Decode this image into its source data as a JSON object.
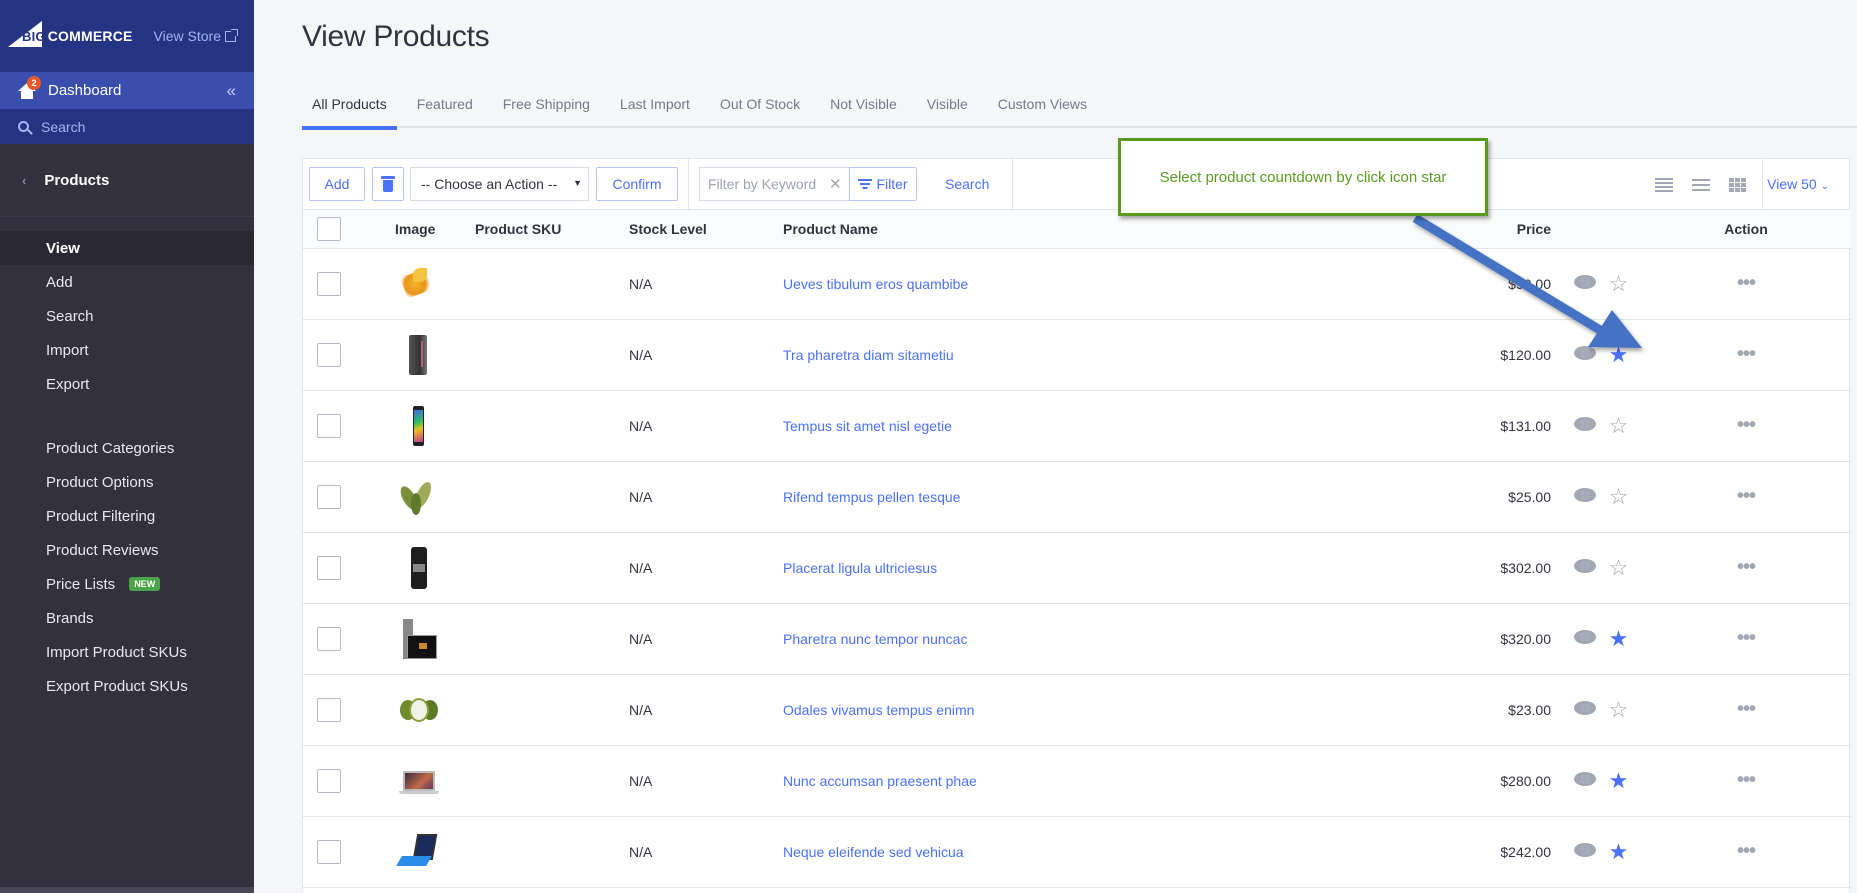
{
  "sidebar": {
    "brand": {
      "big": "BIG",
      "commerce": "COMMERCE"
    },
    "view_store": "View Store",
    "dashboard": {
      "label": "Dashboard",
      "badge": "2"
    },
    "search": "Search",
    "section_title": "Products",
    "items": [
      {
        "label": "View",
        "active": true
      },
      {
        "label": "Add"
      },
      {
        "label": "Search"
      },
      {
        "label": "Import"
      },
      {
        "label": "Export"
      }
    ],
    "items2": [
      {
        "label": "Product Categories"
      },
      {
        "label": "Product Options"
      },
      {
        "label": "Product Filtering"
      },
      {
        "label": "Product Reviews"
      },
      {
        "label": "Price Lists",
        "badge": "NEW"
      },
      {
        "label": "Brands"
      },
      {
        "label": "Import Product SKUs"
      },
      {
        "label": "Export Product SKUs"
      }
    ]
  },
  "page": {
    "title": "View Products",
    "tabs": [
      "All Products",
      "Featured",
      "Free Shipping",
      "Last Import",
      "Out Of Stock",
      "Not Visible",
      "Visible",
      "Custom Views"
    ],
    "active_tab": "All Products"
  },
  "toolbar": {
    "add_label": "Add",
    "action_select": "-- Choose an Action --",
    "confirm_label": "Confirm",
    "filter_placeholder": "Filter by Keyword",
    "filter_label": "Filter",
    "search_label": "Search",
    "view_count": "View 50"
  },
  "table": {
    "columns": [
      "Image",
      "Product SKU",
      "Stock Level",
      "Product Name",
      "Price",
      "Action"
    ],
    "rows": [
      {
        "sku": "",
        "stock": "N/A",
        "name": "Ueves tibulum eros quambibe",
        "price": "$99.00",
        "featured": false,
        "img": "flower"
      },
      {
        "sku": "",
        "stock": "N/A",
        "name": "Tra pharetra diam sitametiu",
        "price": "$120.00",
        "featured": true,
        "img": "phone-dark"
      },
      {
        "sku": "",
        "stock": "N/A",
        "name": "Tempus sit amet nisl egetie",
        "price": "$131.00",
        "featured": false,
        "img": "phone-color"
      },
      {
        "sku": "",
        "stock": "N/A",
        "name": "Rifend tempus pellen tesque",
        "price": "$25.00",
        "featured": false,
        "img": "peppers"
      },
      {
        "sku": "",
        "stock": "N/A",
        "name": "Placerat ligula ultriciesus",
        "price": "$302.00",
        "featured": false,
        "img": "phone-black"
      },
      {
        "sku": "",
        "stock": "N/A",
        "name": "Pharetra nunc tempor nuncac",
        "price": "$320.00",
        "featured": true,
        "img": "tablet"
      },
      {
        "sku": "",
        "stock": "N/A",
        "name": "Odales vivamus tempus enimn",
        "price": "$23.00",
        "featured": false,
        "img": "fruit"
      },
      {
        "sku": "",
        "stock": "N/A",
        "name": "Nunc accumsan praesent phae",
        "price": "$280.00",
        "featured": true,
        "img": "laptop"
      },
      {
        "sku": "",
        "stock": "N/A",
        "name": "Neque eleifende sed vehicua",
        "price": "$242.00",
        "featured": true,
        "img": "surface"
      }
    ]
  },
  "annotation": {
    "text": "Select product countdown by click icon star"
  },
  "colors": {
    "accent": "#4b71fc",
    "sidebar_bg": "#34313f",
    "sidebar_top": "#253482",
    "annotation_green": "#5a9a22",
    "arrow_blue": "#4472c4"
  }
}
